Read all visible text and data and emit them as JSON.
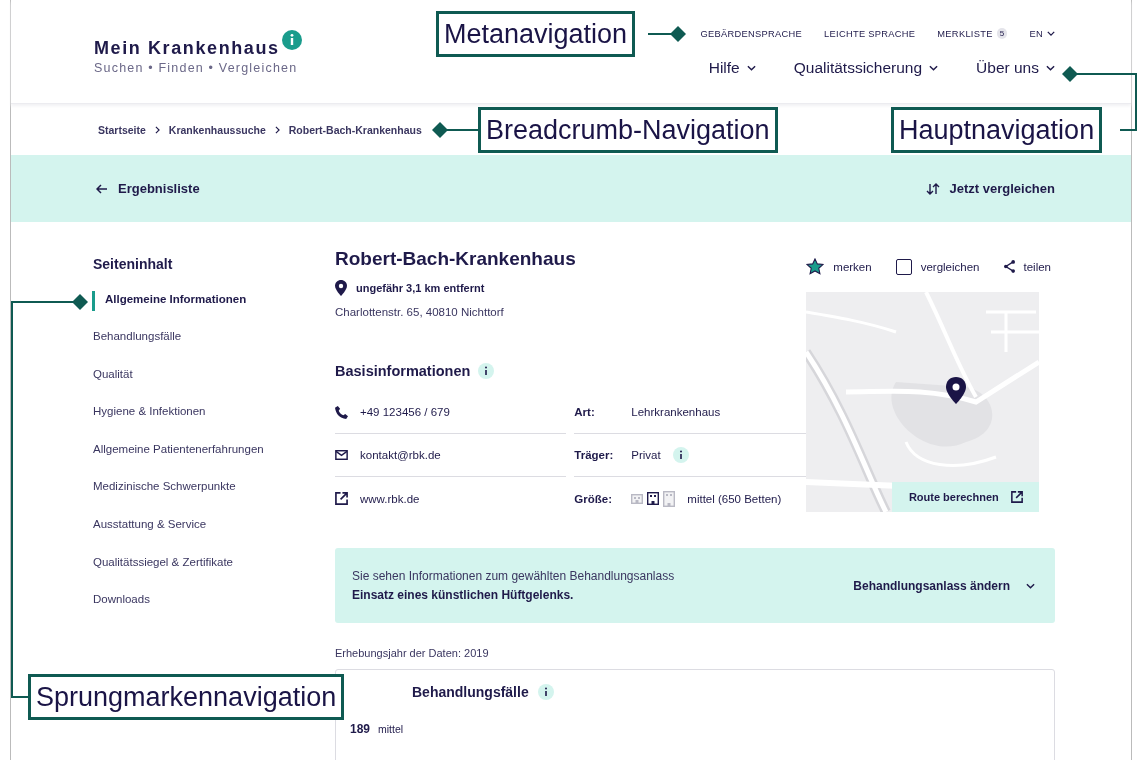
{
  "header": {
    "logo": {
      "title": "Mein Krankenhaus",
      "tagline": "Suchen • Finden • Vergleichen",
      "info": true
    },
    "meta_nav": [
      {
        "label": "GEBÄRDENSPRACHE"
      },
      {
        "label": "LEICHTE SPRACHE"
      },
      {
        "label": "MERKLISTE",
        "badge": "5"
      },
      {
        "label": "EN",
        "dropdown": true
      }
    ],
    "main_nav": [
      {
        "label": "Hilfe"
      },
      {
        "label": "Qualitätssicherung"
      },
      {
        "label": "Über uns"
      }
    ]
  },
  "breadcrumb": [
    "Startseite",
    "Krankenhaussuche",
    "Robert-Bach-Krankenhaus"
  ],
  "actionbar": {
    "back": "Ergebnisliste",
    "compare": "Jetzt vergleichen"
  },
  "toc": {
    "title": "Seiteninhalt",
    "items": [
      {
        "label": "Allgemeine Informationen",
        "selected": true
      },
      {
        "label": "Behandlungsfälle",
        "selected": false
      },
      {
        "label": "Qualität",
        "selected": false
      },
      {
        "label": "Hygiene & Infektionen",
        "selected": false
      },
      {
        "label": "Allgemeine Patientenerfahrungen",
        "selected": false
      },
      {
        "label": "Medizinische Schwerpunkte",
        "selected": false
      },
      {
        "label": "Ausstattung & Service",
        "selected": false
      },
      {
        "label": "Qualitätssiegel & Zertifikate",
        "selected": false
      },
      {
        "label": "Downloads",
        "selected": false
      }
    ]
  },
  "hospital": {
    "name": "Robert-Bach-Krankenhaus",
    "distance": "ungefähr 3,1 km entfernt",
    "address": "Charlottenstr. 65, 40810 Nichttorf",
    "actions": [
      {
        "kind": "bookmark",
        "label": "merken",
        "on": true
      },
      {
        "kind": "compare",
        "label": "vergleichen",
        "checked": false
      },
      {
        "kind": "share",
        "label": "teilen"
      }
    ]
  },
  "basic_info": {
    "title": "Basisinformationen",
    "contacts": [
      {
        "kind": "phone",
        "value": "+49 123456 / 679"
      },
      {
        "kind": "email",
        "value": "kontakt@rbk.de"
      },
      {
        "kind": "web",
        "value": "www.rbk.de"
      }
    ],
    "facts": [
      {
        "kind": "text",
        "label": "Art:",
        "value": "Lehrkrankenhaus"
      },
      {
        "kind": "info",
        "label": "Träger:",
        "value": "Privat"
      },
      {
        "kind": "size",
        "label": "Größe:",
        "value": "mittel (650 Betten)",
        "sizes": [
          {
            "selected": false
          },
          {
            "selected": true
          },
          {
            "selected": false
          }
        ]
      }
    ]
  },
  "map": {
    "kind": "picture",
    "route_button": "Route berechnen"
  },
  "notice": {
    "text": "Sie sehen Informationen zum gewählten Behandlungsanlass",
    "topic": "Einsatz eines künstlichen Hüftgelenks.",
    "button": "Behandlungsanlass ändern"
  },
  "survey_year": "Erhebungsjahr der Daten: 2019",
  "cases_card": {
    "title": "Behandlungsfälle",
    "count": "189",
    "rating": "mittel"
  },
  "annotations": [
    {
      "label": "Metanavigation"
    },
    {
      "label": "Breadcrumb-Navigation"
    },
    {
      "label": "Hauptnavigation"
    },
    {
      "label": "Sprungmarkennavigation"
    }
  ]
}
